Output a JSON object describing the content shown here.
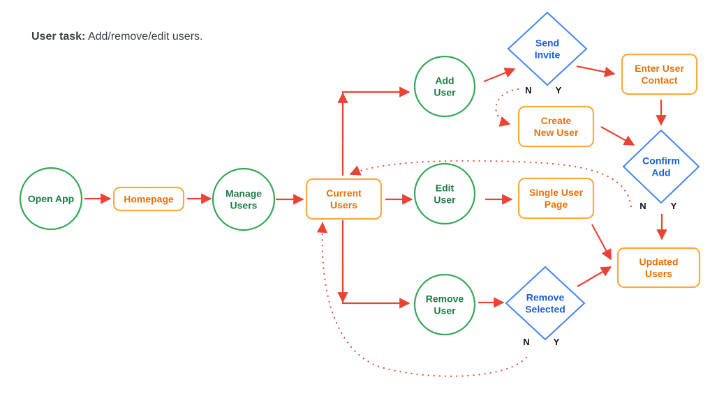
{
  "header": {
    "label": "User task:",
    "text": "Add/remove/edit users."
  },
  "colors": {
    "start_node": "#34a853",
    "page_node": "#f9ab3b",
    "decision_node": "#4285f4",
    "arrow": "#ea4335"
  },
  "nodes": {
    "open_app": {
      "type": "circle",
      "lines": [
        "Open App"
      ]
    },
    "homepage": {
      "type": "rect",
      "lines": [
        "Homepage"
      ]
    },
    "manage_users": {
      "type": "circle",
      "lines": [
        "Manage",
        "Users"
      ]
    },
    "current_users": {
      "type": "rect",
      "lines": [
        "Current",
        "Users"
      ]
    },
    "add_user": {
      "type": "circle",
      "lines": [
        "Add",
        "User"
      ]
    },
    "edit_user": {
      "type": "circle",
      "lines": [
        "Edit",
        "User"
      ]
    },
    "remove_user": {
      "type": "circle",
      "lines": [
        "Remove",
        "User"
      ]
    },
    "send_invite": {
      "type": "diamond",
      "lines": [
        "Send",
        "Invite"
      ]
    },
    "enter_user_contact": {
      "type": "rect",
      "lines": [
        "Enter User",
        "Contact"
      ]
    },
    "create_new_user": {
      "type": "rect",
      "lines": [
        "Create",
        "New User"
      ]
    },
    "confirm_add": {
      "type": "diamond",
      "lines": [
        "Confirm",
        "Add"
      ]
    },
    "single_user_page": {
      "type": "rect",
      "lines": [
        "Single User",
        "Page"
      ]
    },
    "remove_selected": {
      "type": "diamond",
      "lines": [
        "Remove",
        "Selected"
      ]
    },
    "updated_users": {
      "type": "rect",
      "lines": [
        "Updated",
        "Users"
      ]
    }
  },
  "decision_labels": {
    "no": "N",
    "yes": "Y"
  },
  "edges": [
    {
      "from": "open_app",
      "to": "homepage",
      "style": "solid"
    },
    {
      "from": "homepage",
      "to": "manage_users",
      "style": "solid"
    },
    {
      "from": "manage_users",
      "to": "current_users",
      "style": "solid"
    },
    {
      "from": "current_users",
      "to": "add_user",
      "style": "solid"
    },
    {
      "from": "current_users",
      "to": "edit_user",
      "style": "solid"
    },
    {
      "from": "current_users",
      "to": "remove_user",
      "style": "solid"
    },
    {
      "from": "add_user",
      "to": "send_invite",
      "style": "solid"
    },
    {
      "from": "send_invite",
      "to": "enter_user_contact",
      "label": "Y",
      "style": "solid"
    },
    {
      "from": "send_invite",
      "to": "create_new_user",
      "label": "N",
      "style": "dotted"
    },
    {
      "from": "enter_user_contact",
      "to": "confirm_add",
      "style": "solid"
    },
    {
      "from": "create_new_user",
      "to": "confirm_add",
      "style": "solid"
    },
    {
      "from": "confirm_add",
      "to": "updated_users",
      "label": "Y",
      "style": "solid"
    },
    {
      "from": "confirm_add",
      "to": "current_users",
      "label": "N",
      "style": "dotted"
    },
    {
      "from": "edit_user",
      "to": "single_user_page",
      "style": "solid"
    },
    {
      "from": "single_user_page",
      "to": "updated_users",
      "style": "solid"
    },
    {
      "from": "remove_user",
      "to": "remove_selected",
      "style": "solid"
    },
    {
      "from": "remove_selected",
      "to": "updated_users",
      "label": "Y",
      "style": "solid"
    },
    {
      "from": "remove_selected",
      "to": "current_users",
      "label": "N",
      "style": "dotted"
    }
  ]
}
